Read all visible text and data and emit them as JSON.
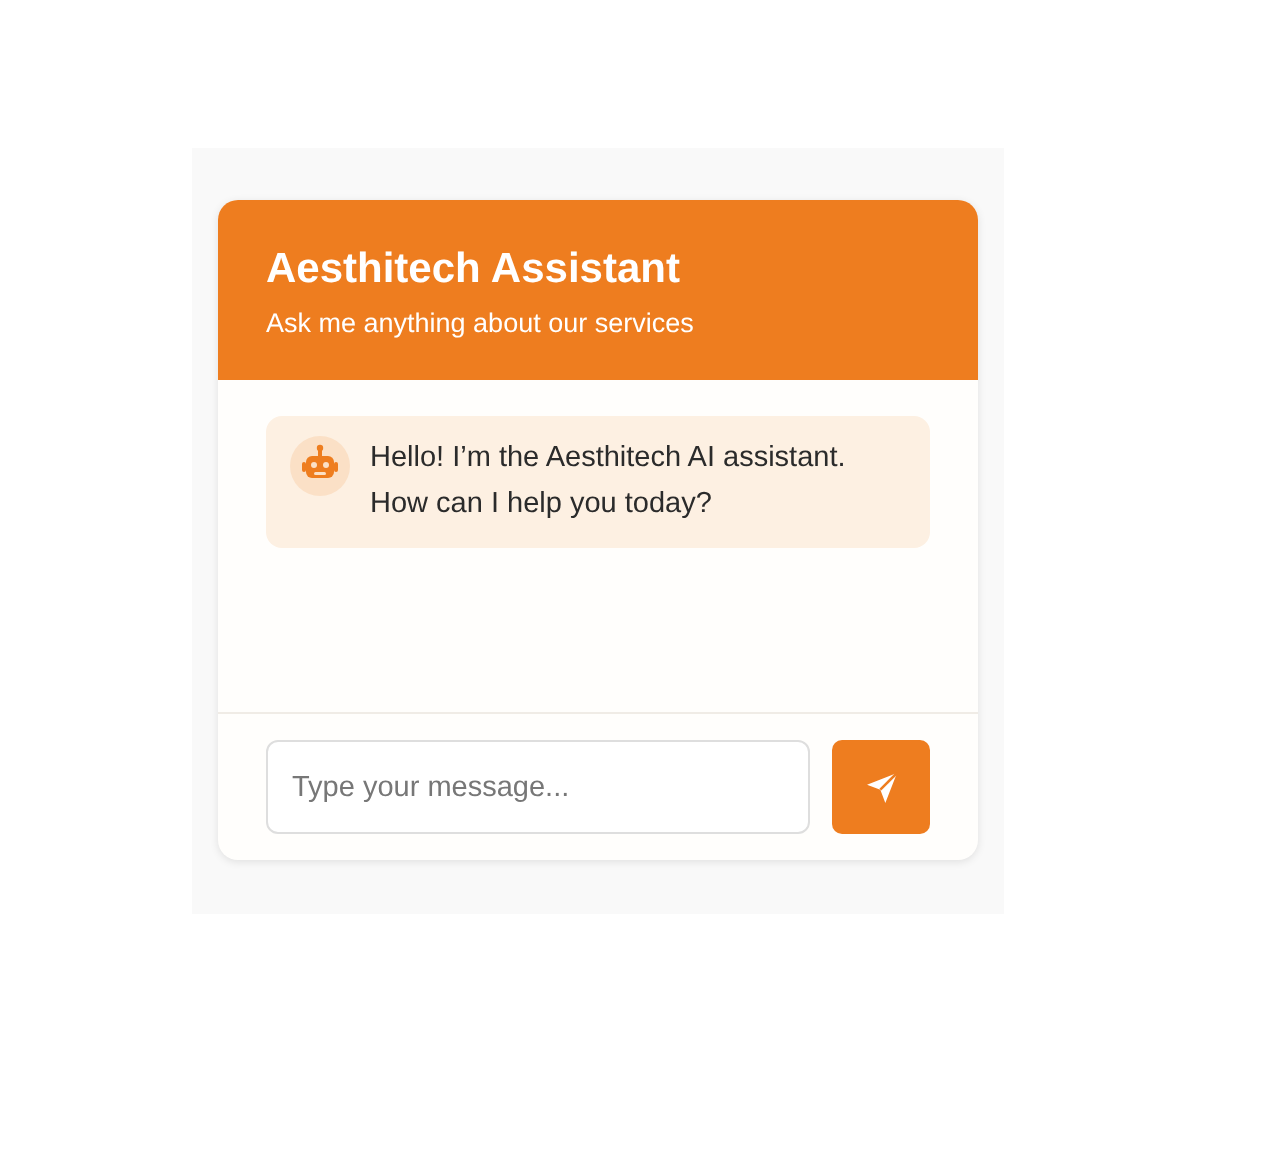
{
  "header": {
    "title": "Aesthitech Assistant",
    "subtitle": "Ask me anything about our services"
  },
  "messages": [
    {
      "kind": "bot",
      "lines": [
        "Hello! I’m the Aesthitech AI assistant.",
        "How can I help you today?"
      ]
    }
  ],
  "composer": {
    "placeholder": "Type your message..."
  }
}
